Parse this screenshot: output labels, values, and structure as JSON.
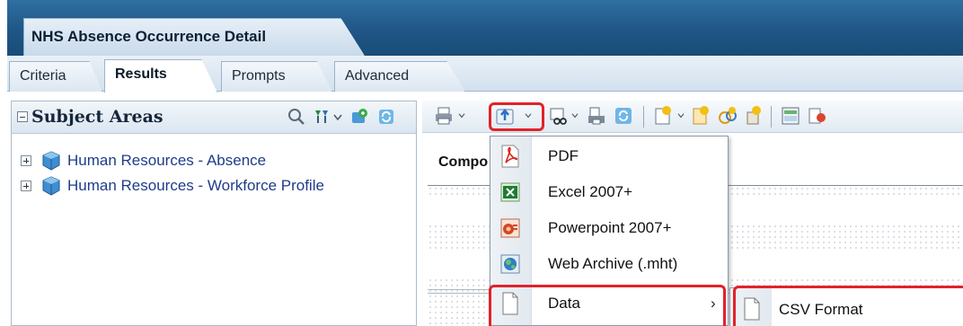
{
  "title_tab": "NHS Absence Occurrence Detail",
  "tabs": [
    {
      "label": "Criteria",
      "active": false
    },
    {
      "label": "Results",
      "active": true
    },
    {
      "label": "Prompts",
      "active": false
    },
    {
      "label": "Advanced",
      "active": false
    }
  ],
  "subject_areas": {
    "title": "Subject Areas",
    "items": [
      {
        "label": "Human Resources - Absence"
      },
      {
        "label": "Human Resources - Workforce Profile"
      }
    ]
  },
  "results": {
    "compound_label": "Compo"
  },
  "export_menu": {
    "items": [
      {
        "label": "PDF",
        "icon": "pdf-icon"
      },
      {
        "label": "Excel 2007+",
        "icon": "excel-icon"
      },
      {
        "label": "Powerpoint 2007+",
        "icon": "powerpoint-icon"
      },
      {
        "label": "Web Archive (.mht)",
        "icon": "web-archive-icon"
      },
      {
        "label": "Data",
        "icon": "document-icon",
        "arrow": "›"
      }
    ]
  },
  "data_submenu": {
    "items": [
      {
        "label": "CSV Format",
        "icon": "document-icon"
      }
    ]
  },
  "colors": {
    "title_band": "#1f5686",
    "highlight": "#e2222a",
    "tree_link": "#1e3c8a"
  }
}
